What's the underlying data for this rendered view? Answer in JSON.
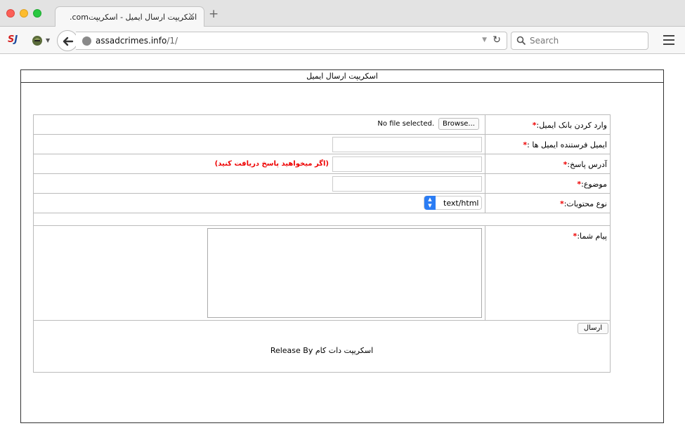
{
  "browser": {
    "tab_title": ".comاسکریپت ارسال ایمیل - اسکریپت",
    "tab_close": "✕",
    "new_tab": "+",
    "url_domain": "assadcrimes.info",
    "url_path": "/1/",
    "search_placeholder": "Search",
    "ext_label_a": "S",
    "ext_label_b": "J"
  },
  "page": {
    "frame_title": "اسکریپت ارسال ایمیل",
    "required_mark": "*",
    "fields": {
      "email_bank": {
        "label": "وارد کردن بانک ایمیل:",
        "browse_label": "Browse...",
        "file_status": "No file selected."
      },
      "sender_email": {
        "label": "ایمیل فرستنده ایمیل ها :",
        "value": ""
      },
      "reply_address": {
        "label": "آدرس پاسخ:",
        "value": "",
        "hint": "(اگر میخواهید پاسخ دریافت کنید)"
      },
      "subject": {
        "label": "موضوع:",
        "value": ""
      },
      "content_type": {
        "label": "نوع محتویات:",
        "selected": "text/html"
      },
      "message": {
        "label": "پیام شما:",
        "value": ""
      }
    },
    "submit_label": "ارسال",
    "release_text": "اسکریپت دات کام Release By"
  }
}
